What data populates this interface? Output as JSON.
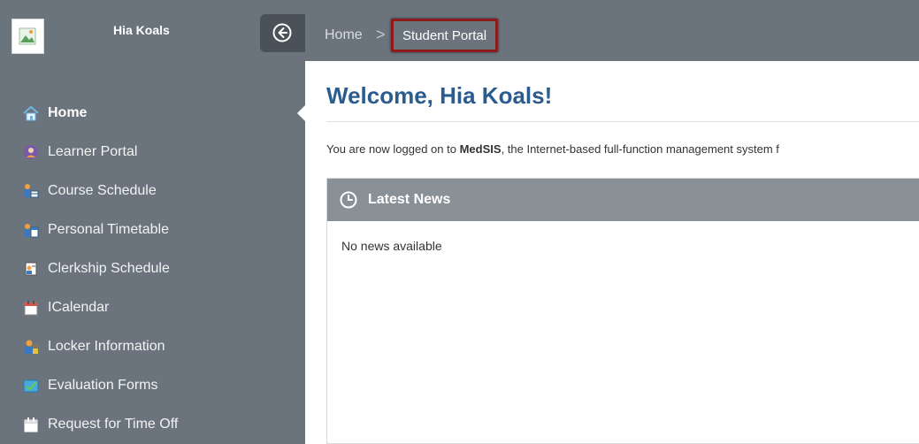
{
  "user": {
    "name": "Hia Koals"
  },
  "breadcrumb": {
    "home": "Home",
    "separator": ">",
    "current": "Student Portal"
  },
  "sidebar": {
    "items": [
      {
        "label": "Home",
        "icon": "house-icon",
        "active": true
      },
      {
        "label": "Learner Portal",
        "icon": "learner-icon"
      },
      {
        "label": "Course Schedule",
        "icon": "course-schedule-icon"
      },
      {
        "label": "Personal Timetable",
        "icon": "timetable-icon"
      },
      {
        "label": "Clerkship Schedule",
        "icon": "clerkship-icon"
      },
      {
        "label": "ICalendar",
        "icon": "calendar-icon"
      },
      {
        "label": "Locker Information",
        "icon": "locker-icon"
      },
      {
        "label": "Evaluation Forms",
        "icon": "evaluation-icon"
      },
      {
        "label": "Request for Time Off",
        "icon": "time-off-icon"
      }
    ]
  },
  "main": {
    "welcome": "Welcome, Hia Koals!",
    "intro_prefix": "You are now logged on to ",
    "intro_brand": "MedSIS",
    "intro_suffix": ", the Internet-based full-function management system f",
    "news": {
      "title": "Latest News",
      "empty": "No news available"
    }
  },
  "colors": {
    "sidebar": "#6b747c",
    "accent_title": "#2a5c8f",
    "highlight_border": "#8b1a1a",
    "news_header": "#8a9196"
  }
}
